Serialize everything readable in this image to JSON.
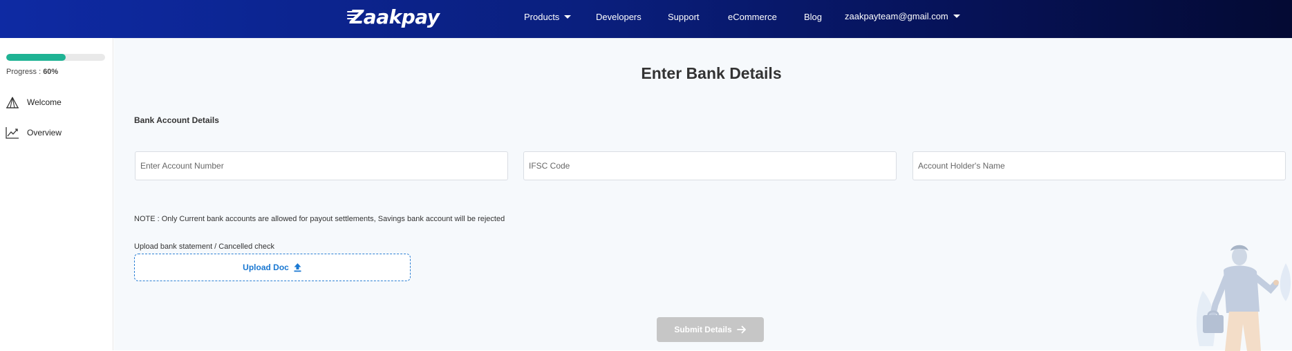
{
  "header": {
    "brand": "Zaakpay",
    "nav": {
      "products": "Products",
      "developers": "Developers",
      "support": "Support",
      "ecommerce": "eCommerce",
      "blog": "Blog",
      "account_email": "zaakpayteam@gmail.com"
    },
    "background_colors": [
      "#0e2aa3",
      "#040a33"
    ]
  },
  "sidebar": {
    "progress": {
      "label": "Progress : ",
      "value_text": "60%",
      "value": 0.6,
      "color": "#1fb394"
    },
    "items": [
      {
        "label": "Welcome",
        "icon": "tent-icon"
      },
      {
        "label": "Overview",
        "icon": "trend-chart-icon"
      }
    ]
  },
  "main": {
    "title": "Enter Bank Details",
    "section_label": "Bank Account Details",
    "fields": {
      "account_number_placeholder": "Enter Account Number",
      "ifsc_placeholder": "IFSC Code",
      "holder_name_placeholder": "Account Holder's Name"
    },
    "note": "NOTE : Only Current bank accounts are allowed for payout settlements, Savings bank account will be rejected",
    "upload": {
      "label": "Upload bank statement / Cancelled check",
      "button_label": "Upload Doc",
      "icon": "upload-arrow-icon",
      "accent": "#1a78d2"
    },
    "submit": {
      "label": "Submit Details",
      "icon": "arrow-right-icon",
      "disabled_color": "#c6c6c6"
    }
  }
}
